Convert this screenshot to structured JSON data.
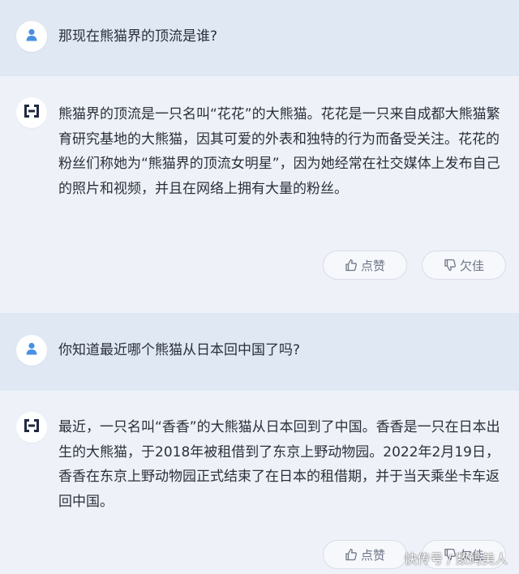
{
  "conversation": [
    {
      "role": "user",
      "text": "那现在熊猫界的顶流是谁?"
    },
    {
      "role": "assistant",
      "text": "熊猫界的顶流是一只名叫“花花”的大熊猫。花花是一只来自成都大熊猫繁育研究基地的大熊猫，因其可爱的外表和独特的行为而备受关注。花花的粉丝们称她为“熊猫界的顶流女明星”，因为她经常在社交媒体上发布自己的照片和视频，并且在网络上拥有大量的粉丝。",
      "like_label": "点赞",
      "dislike_label": "欠佳"
    },
    {
      "role": "user",
      "text": "你知道最近哪个熊猫从日本回中国了吗?"
    },
    {
      "role": "assistant",
      "text": "最近，一只名叫“香香”的大熊猫从日本回到了中国。香香是一只在日本出生的大熊猫，于2018年被租借到了东京上野动物园。2022年2月19日，香香在东京上野动物园正式结束了在日本的租借期，并于当天乘坐卡车返回中国。",
      "like_label": "点赞",
      "dislike_label": "欠佳"
    }
  ],
  "watermark": "快传号 / 数码美人",
  "icons": {
    "user_avatar": "user-icon",
    "bot_avatar": "bot-logo-icon",
    "like": "thumbs-up-icon",
    "dislike": "thumbs-down-icon"
  },
  "colors": {
    "user_row_bg": "#dfe8f3",
    "bot_row_bg": "#eef2f8",
    "user_icon": "#4a90e2",
    "bot_logo": "#1f2a3d",
    "text": "#2a2f3a",
    "button_text": "#6f7686"
  }
}
